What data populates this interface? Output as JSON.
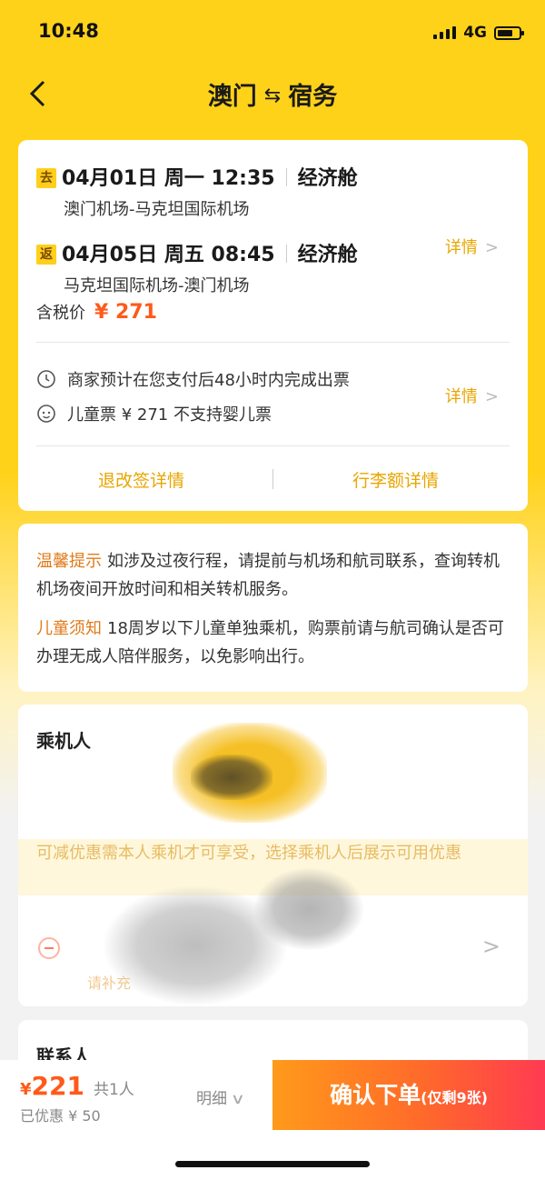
{
  "status": {
    "time": "10:48",
    "network": "4G"
  },
  "nav": {
    "origin": "澳门",
    "arrow": "⇆",
    "destination": "宿务"
  },
  "flight": {
    "outbound": {
      "tag": "去",
      "date": "04月01日 周一 12:35",
      "cabin": "经济舱",
      "route": "澳门机场-马克坦国际机场"
    },
    "return": {
      "tag": "返",
      "date": "04月05日 周五 08:45",
      "cabin": "经济舱",
      "route": "马克坦国际机场-澳门机场"
    },
    "price_label": "含税价",
    "price": "¥ 271",
    "detail_label": "详情",
    "ticket_notice": "商家预计在您支付后48小时内完成出票",
    "child_notice": "儿童票 ¥ 271  不支持婴儿票",
    "detail_label_2": "详情",
    "change_rules": "退改签详情",
    "baggage_rules": "行李额详情"
  },
  "tips": {
    "warm_head": "温馨提示",
    "warm_text": "如涉及过夜行程，请提前与机场和航司联系，查询转机机场夜间开放时间和相关转机服务。",
    "child_head": "儿童须知",
    "child_text": "18周岁以下儿童单独乘机，购票前请与航司确认是否可办理无成人陪伴服务，以免影响出行。"
  },
  "passenger": {
    "title": "乘机人",
    "coupon_hint": "可减优惠需本人乘机才可享受，选择乘机人后展示可用优惠",
    "complete_hint": "请补充"
  },
  "contact": {
    "title": "联系人"
  },
  "bottom": {
    "currency": "¥",
    "total": "221",
    "count": "共1人",
    "saved": "已优惠 ¥ 50",
    "breakdown": "明细",
    "confirm": "确认下单",
    "remaining": "(仅剩9张)"
  }
}
